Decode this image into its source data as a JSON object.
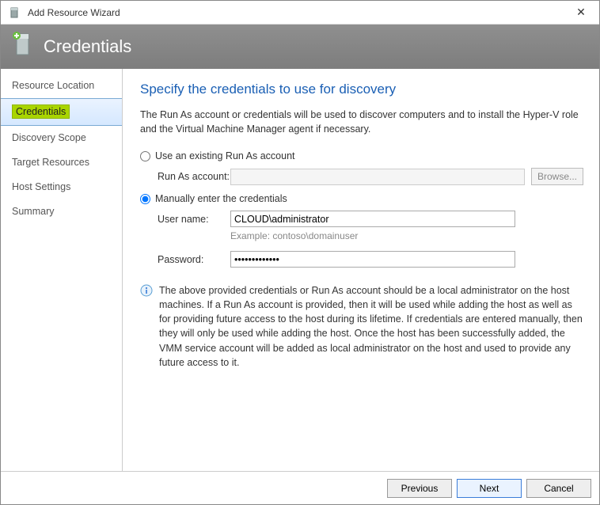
{
  "window": {
    "title": "Add Resource Wizard"
  },
  "banner": {
    "title": "Credentials"
  },
  "sidebar": {
    "items": [
      {
        "label": "Resource Location"
      },
      {
        "label": "Credentials"
      },
      {
        "label": "Discovery Scope"
      },
      {
        "label": "Target Resources"
      },
      {
        "label": "Host Settings"
      },
      {
        "label": "Summary"
      }
    ],
    "activeIndex": 1
  },
  "page": {
    "title": "Specify the credentials to use for discovery",
    "intro": "The Run As account or credentials will be used to discover computers and to install the Hyper-V role and the Virtual Machine Manager agent if necessary.",
    "radio_existing": "Use an existing Run As account",
    "runas_label": "Run As account:",
    "browse_label": "Browse...",
    "radio_manual": "Manually enter the credentials",
    "username_label": "User name:",
    "username_value": "CLOUD\\administrator",
    "username_hint": "Example: contoso\\domainuser",
    "password_label": "Password:",
    "password_value": "•••••••••••••",
    "info_text": "The above provided credentials or Run As account should be a local administrator on the host machines. If a Run As account is provided, then it will be used while adding the host as well as for providing future access to the host during its lifetime. If credentials are entered manually, then they will only be used while adding the host. Once the host has been successfully added, the VMM service account will be added as local administrator on the host and used to provide any future access to it."
  },
  "footer": {
    "previous": "Previous",
    "next": "Next",
    "cancel": "Cancel"
  }
}
